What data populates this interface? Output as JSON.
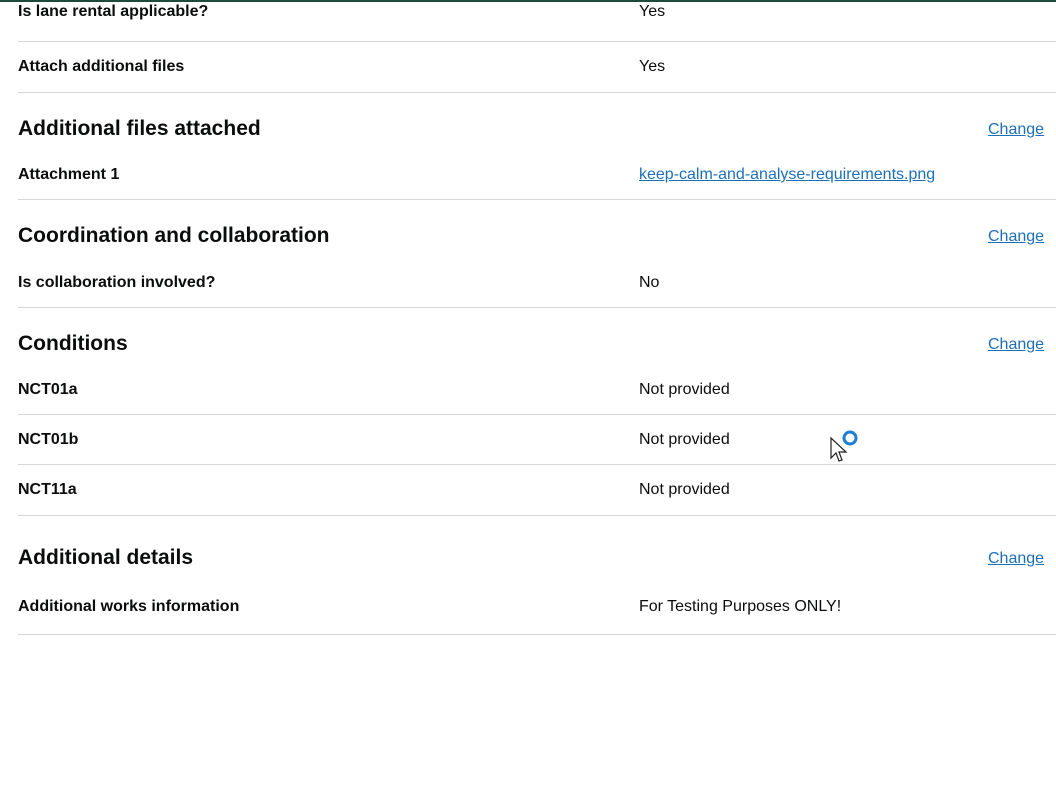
{
  "sections": {
    "lane_rental": {
      "rows": [
        {
          "key": "Is lane rental applicable?",
          "value": "Yes"
        },
        {
          "key": "Attach additional files",
          "value": "Yes"
        }
      ]
    },
    "additional_files": {
      "title": "Additional files attached",
      "change_label": "Change",
      "rows": [
        {
          "key": "Attachment 1",
          "value": "keep-calm-and-analyse-requirements.png"
        }
      ]
    },
    "coordination": {
      "title": "Coordination and collaboration",
      "change_label": "Change",
      "rows": [
        {
          "key": "Is collaboration involved?",
          "value": "No"
        }
      ]
    },
    "conditions": {
      "title": "Conditions",
      "change_label": "Change",
      "rows": [
        {
          "key": "NCT01a",
          "value": "Not provided"
        },
        {
          "key": "NCT01b",
          "value": "Not provided"
        },
        {
          "key": "NCT11a",
          "value": "Not provided"
        }
      ]
    },
    "additional_details": {
      "title": "Additional details",
      "change_label": "Change",
      "rows": [
        {
          "key": "Additional works information",
          "value": "For Testing Purposes ONLY!"
        }
      ]
    }
  },
  "colors": {
    "link": "#1d70b8",
    "text": "#0b0c0c",
    "border": "#d6d6d6",
    "cursor_ring": "#1d7fd6"
  },
  "icons": {
    "cursor": "busy-pointer-icon"
  }
}
